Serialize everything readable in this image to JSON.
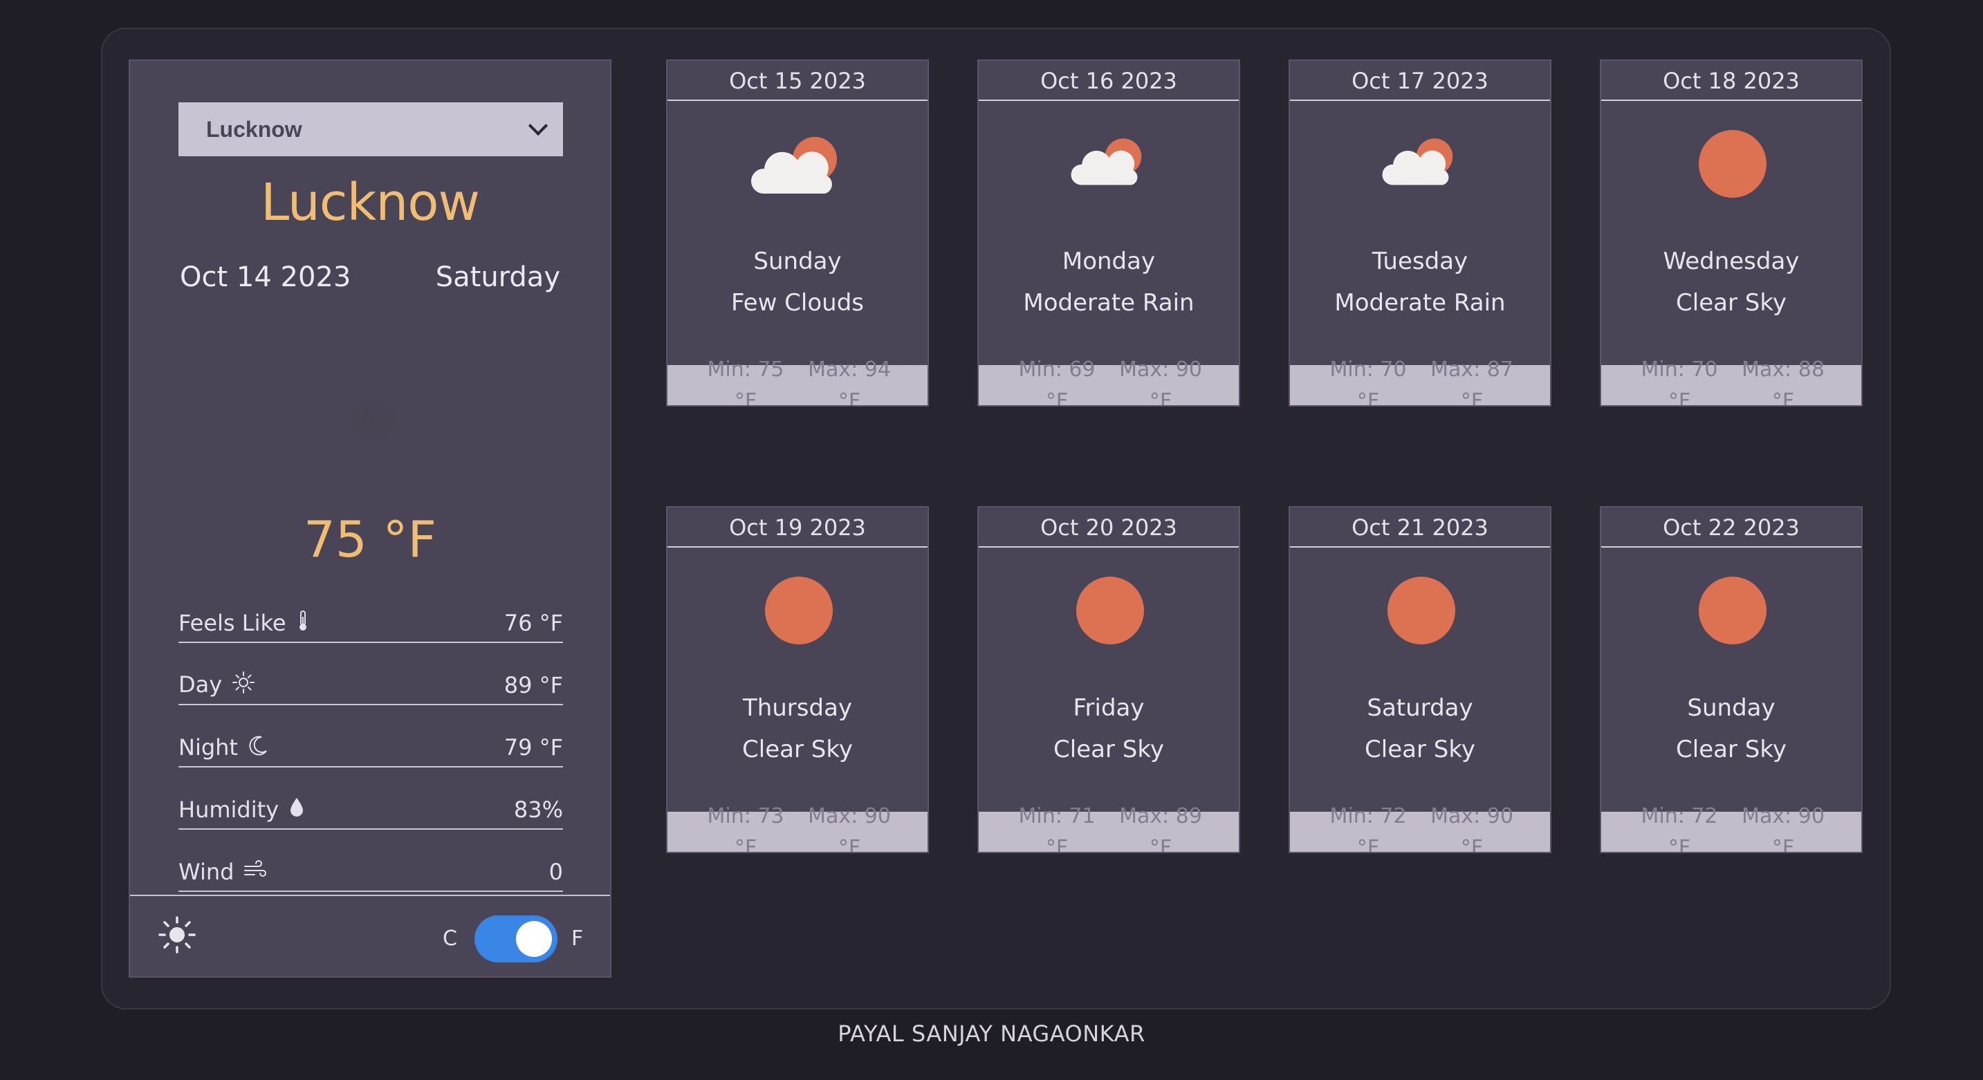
{
  "city_select": {
    "value": "Lucknow"
  },
  "current": {
    "city": "Lucknow",
    "date": "Oct 14 2023",
    "day": "Saturday",
    "temp": "75 °F",
    "stats": [
      {
        "label": "Feels Like",
        "icon": "thermometer-icon",
        "value": "76 °F"
      },
      {
        "label": "Day",
        "icon": "sun-outline-icon",
        "value": "89 °F"
      },
      {
        "label": "Night",
        "icon": "moon-icon",
        "value": "79 °F"
      },
      {
        "label": "Humidity",
        "icon": "droplet-icon",
        "value": "83%"
      },
      {
        "label": "Wind",
        "icon": "wind-icon",
        "value": "0"
      }
    ]
  },
  "units": {
    "c": "C",
    "f": "F",
    "selected": "F"
  },
  "forecast": [
    {
      "date": "Oct 15 2023",
      "day": "Sunday",
      "desc": "Few Clouds",
      "icon": "few-clouds-icon",
      "min": "Min: 75 °F",
      "max": "Max: 94 °F"
    },
    {
      "date": "Oct 16 2023",
      "day": "Monday",
      "desc": "Moderate Rain",
      "icon": "rain-cloud-icon",
      "min": "Min: 69 °F",
      "max": "Max: 90 °F"
    },
    {
      "date": "Oct 17 2023",
      "day": "Tuesday",
      "desc": "Moderate Rain",
      "icon": "rain-cloud-icon",
      "min": "Min: 70 °F",
      "max": "Max: 87 °F"
    },
    {
      "date": "Oct 18 2023",
      "day": "Wednesday",
      "desc": "Clear Sky",
      "icon": "sun-icon",
      "min": "Min: 70 °F",
      "max": "Max: 88 °F"
    },
    {
      "date": "Oct 19 2023",
      "day": "Thursday",
      "desc": "Clear Sky",
      "icon": "sun-icon",
      "min": "Min: 73 °F",
      "max": "Max: 90 °F"
    },
    {
      "date": "Oct 20 2023",
      "day": "Friday",
      "desc": "Clear Sky",
      "icon": "sun-icon",
      "min": "Min: 71 °F",
      "max": "Max: 89 °F"
    },
    {
      "date": "Oct 21 2023",
      "day": "Saturday",
      "desc": "Clear Sky",
      "icon": "sun-icon",
      "min": "Min: 72 °F",
      "max": "Max: 90 °F"
    },
    {
      "date": "Oct 22 2023",
      "day": "Sunday",
      "desc": "Clear Sky",
      "icon": "sun-icon",
      "min": "Min: 72 °F",
      "max": "Max: 90 °F"
    }
  ],
  "footer": {
    "author": "PAYAL SANJAY NAGAONKAR"
  },
  "colors": {
    "accent": "#f0bd72",
    "sun": "#dd7252",
    "toggle": "#3a86e6"
  }
}
